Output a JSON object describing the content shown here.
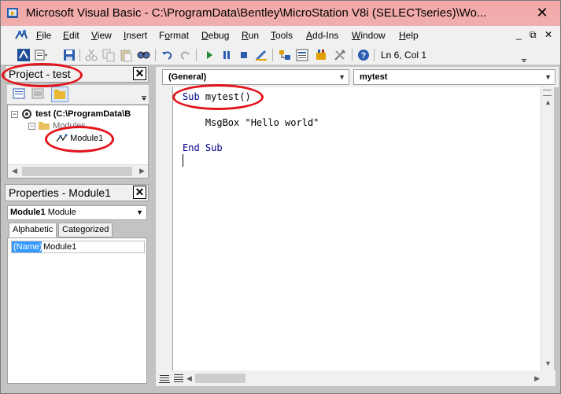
{
  "window": {
    "title": "Microsoft Visual Basic - C:\\ProgramData\\Bentley\\MicroStation V8i (SELECTseries)\\Wo...",
    "close_glyph": "✕"
  },
  "menu": {
    "items": [
      "File",
      "Edit",
      "View",
      "Insert",
      "Format",
      "Debug",
      "Run",
      "Tools",
      "Add-Ins",
      "Window",
      "Help"
    ],
    "underline": [
      "F",
      "E",
      "V",
      "I",
      "o",
      "D",
      "R",
      "T",
      "A",
      "W",
      "H"
    ],
    "mdi_controls": [
      "_",
      "⧉",
      "✕"
    ]
  },
  "toolbar": {
    "cursor_position": "Ln 6, Col 1"
  },
  "project_pane": {
    "title": "Project - test",
    "close_glyph": "✕",
    "tree": {
      "root_label": "test (C:\\ProgramData\\B",
      "folder_label": "Modules",
      "module_label": "Module1"
    }
  },
  "properties_pane": {
    "title": "Properties - Module1",
    "close_glyph": "✕",
    "object_name": "Module1",
    "object_type": "Module",
    "tabs": [
      "Alphabetic",
      "Categorized"
    ],
    "active_tab": "Alphabetic",
    "rows": [
      {
        "name": "(Name)",
        "value": "Module1"
      }
    ]
  },
  "code_window": {
    "object_combo": "(General)",
    "procedure_combo": "mytest",
    "lines": [
      {
        "kw": "Sub",
        "text": " mytest()"
      },
      {
        "kw": "",
        "text": "    MsgBox \"Hello world\""
      },
      {
        "kw": "End Sub",
        "text": ""
      }
    ]
  },
  "colors": {
    "title_bar": "#f3a7a7",
    "annotation": "#e2141c",
    "keyword": "#00008b",
    "selection": "#3399ff"
  }
}
